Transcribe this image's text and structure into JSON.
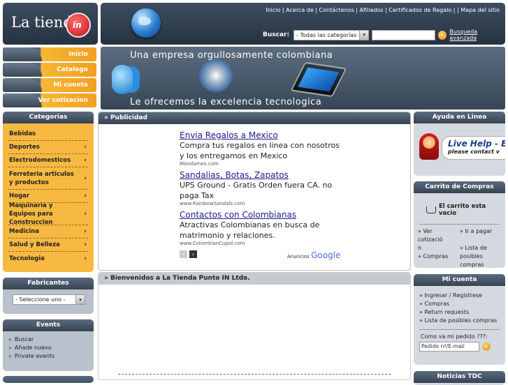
{
  "logo": {
    "text": "La tienda",
    "badge": "in"
  },
  "header": {
    "top_links": "Inicio | Acerca de | Contáctenos | Afiliados | Certificados de Regalo |  | Mapa del sitio",
    "search_label": "Buscar:",
    "category_select": "- Todas las categorías -",
    "search_value": "",
    "advanced_search": "Busqueda avanzada"
  },
  "nav": {
    "items": [
      {
        "label": "Inicio"
      },
      {
        "label": "Catalogo"
      },
      {
        "label": "Mi cuenta"
      },
      {
        "label": "Ver cotizacion"
      }
    ]
  },
  "banner": {
    "line1": "Una empresa orgullosamente colombiana",
    "line2": "Le ofrecemos la excelencia tecnologica"
  },
  "categories": {
    "title": "Categorias",
    "items": [
      {
        "label": "Bebidas",
        "has_sub": false
      },
      {
        "label": "Deportes",
        "has_sub": true
      },
      {
        "label": "Electrodomesticos",
        "has_sub": true
      },
      {
        "label": "Ferreteria articulos y productos",
        "has_sub": true
      },
      {
        "label": "Hogar",
        "has_sub": true
      },
      {
        "label": "Maquinaria y Equipos para Construccion",
        "has_sub": true
      },
      {
        "label": "Medicina",
        "has_sub": true
      },
      {
        "label": "Salud y Belleza",
        "has_sub": true
      },
      {
        "label": "Tecnologia",
        "has_sub": true
      }
    ]
  },
  "manufacturers": {
    "title": "Fabricantes",
    "select": "- Seleccione uno -"
  },
  "events": {
    "title": "Events",
    "items": [
      "Buscar",
      "Añade nuevo",
      "Private events"
    ]
  },
  "publicidad": {
    "title": "Publicidad",
    "ads": [
      {
        "title": "Envia Regalos a Mexico",
        "body": "Compra tus regalos en linea con nosotros y los entregamos en Mexico",
        "url": "Mandamex.com"
      },
      {
        "title": "Sandalias, Botas, Zapatos",
        "body": "UPS Ground - Gratis Orden fuera CA. no paga Tax",
        "url": "www.RainbowSandals.com"
      },
      {
        "title": "Contactos con Colombianas",
        "body": "Atractivas Colombianas en busca de matrimonio y relaciones.",
        "url": "www.ColombianCupid.com"
      }
    ],
    "ads_by": "Anuncios",
    "ads_brand": "Google"
  },
  "welcome": {
    "title": "Bienvenidos a La Tienda Punto IN Ltda."
  },
  "help": {
    "title": "Ayuda en Linea",
    "live_help": "Live Help - En",
    "contact": "please contact v"
  },
  "cart": {
    "title": "Carrito de Compras",
    "empty": "El carrito esta vacio",
    "col1": [
      "Ver cotizació",
      "n",
      "Compras"
    ],
    "col2": [
      "Ir a pagar",
      "",
      "Lista de posibles compras"
    ]
  },
  "account": {
    "title": "Mi cuenta",
    "links": [
      "Ingresar / Registrese",
      "Compras",
      "Return requests",
      "Lista de posibles compras"
    ],
    "order_label": "Como va mi pedido ???:",
    "order_placeholder": "Pedido nº/E-mail"
  },
  "news": {
    "title": "Noticias TDC"
  }
}
